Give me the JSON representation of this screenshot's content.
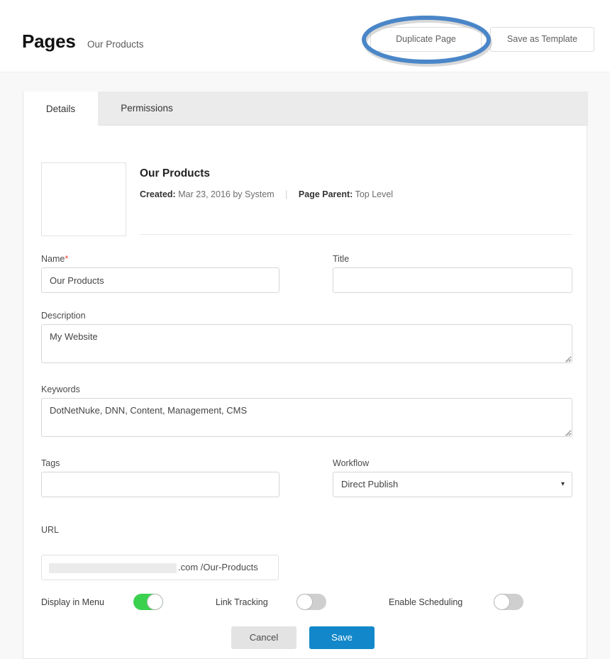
{
  "header": {
    "title": "Pages",
    "subtitle": "Our Products",
    "duplicate_page_label": "Duplicate Page",
    "save_as_template_label": "Save as Template",
    "annotation_color": "#4a86c8"
  },
  "tabs": [
    {
      "label": "Details",
      "active": true
    },
    {
      "label": "Permissions",
      "active": false
    }
  ],
  "page_summary": {
    "name": "Our Products",
    "created_label": "Created:",
    "created_value": "Mar 23, 2016 by System",
    "separator": "|",
    "page_parent_label": "Page Parent:",
    "page_parent_value": "Top Level"
  },
  "form": {
    "name": {
      "label": "Name",
      "required_marker": "*",
      "value": "Our Products",
      "placeholder": ""
    },
    "title": {
      "label": "Title",
      "value": "",
      "placeholder": ""
    },
    "description": {
      "label": "Description",
      "value": "My Website",
      "placeholder": ""
    },
    "keywords": {
      "label": "Keywords",
      "value": "DotNetNuke, DNN, Content, Management, CMS",
      "placeholder": ""
    },
    "tags": {
      "label": "Tags",
      "value": "",
      "placeholder": ""
    },
    "workflow": {
      "label": "Workflow",
      "selected": "Direct Publish",
      "options": [
        "Direct Publish"
      ],
      "caret_icon": "▾"
    },
    "url": {
      "label": "URL",
      "redacted_domain": "",
      "suffix": ".com /Our-Products"
    }
  },
  "toggles": [
    {
      "label": "Display in Menu",
      "state": "on"
    },
    {
      "label": "Link Tracking",
      "state": "off"
    },
    {
      "label": "Enable Scheduling",
      "state": "off"
    }
  ],
  "footer": {
    "cancel_label": "Cancel",
    "save_label": "Save",
    "save_color": "#1288ca"
  }
}
